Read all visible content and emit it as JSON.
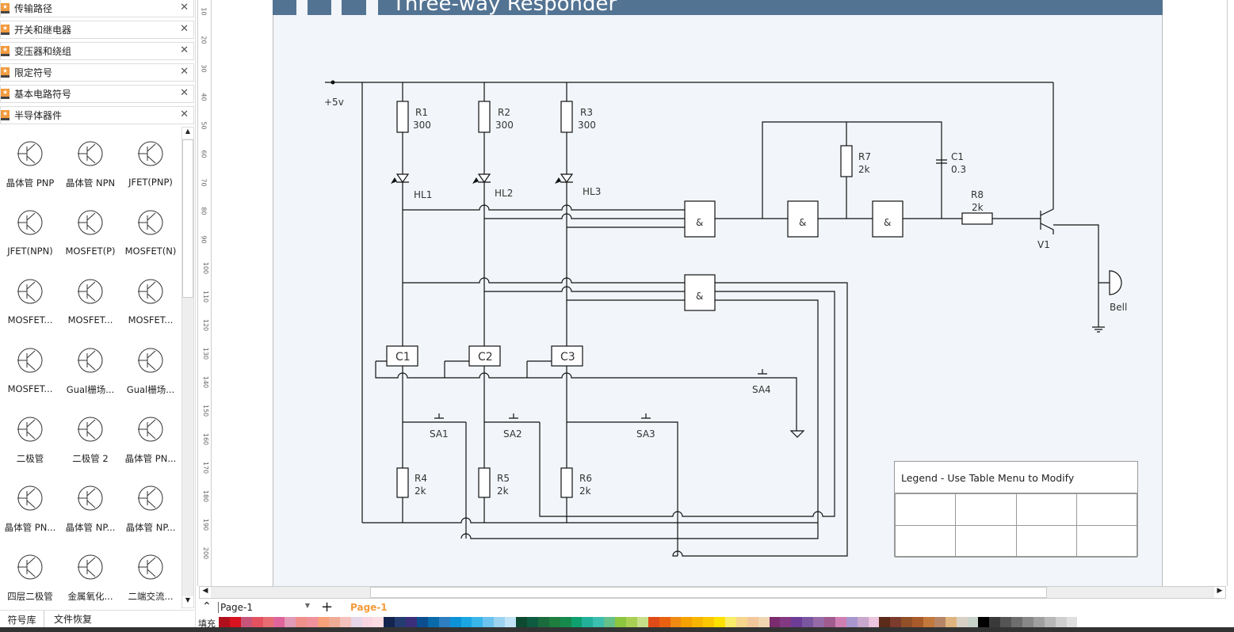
{
  "sidebar": {
    "categories": [
      "传输路径",
      "开关和继电器",
      "变压器和绕组",
      "限定符号",
      "基本电路符号",
      "半导体器件"
    ],
    "shapes": [
      "晶体管 PNP",
      "晶体管 NPN",
      "JFET(PNP)",
      "JFET(NPN)",
      "MOSFET(P)",
      "MOSFET(N)",
      "MOSFET...",
      "MOSFET...",
      "MOSFET...",
      "MOSFET...",
      "Gual栅场...",
      "Gual栅场...",
      "二极管",
      "二极管 2",
      "晶体管 PN...",
      "晶体管 PN...",
      "晶体管 NP...",
      "晶体管 NP...",
      "四层二极管",
      "金属氧化...",
      "二端交流..."
    ],
    "bottom_tabs": [
      "符号库",
      "文件恢复"
    ]
  },
  "ruler": [
    "10",
    "20",
    "30",
    "40",
    "50",
    "60",
    "70",
    "80",
    "90",
    "100",
    "110",
    "120",
    "130",
    "140",
    "150",
    "160",
    "170",
    "180",
    "190",
    "200"
  ],
  "diagram": {
    "title": "Three-way Responder",
    "supply": "+5v",
    "r1": "R1",
    "r1v": "300",
    "r2": "R2",
    "r2v": "300",
    "r3": "R3",
    "r3v": "300",
    "hl1": "HL1",
    "hl2": "HL2",
    "hl3": "HL3",
    "gate": "&",
    "r7": "R7",
    "r7v": "2k",
    "c1": "C1",
    "c1v": "0.3",
    "r8": "R8",
    "r8v": "2k",
    "v1": "V1",
    "bell": "Bell",
    "cc1": "C1",
    "cc2": "C2",
    "cc3": "C3",
    "sa1": "SA1",
    "sa2": "SA2",
    "sa3": "SA3",
    "sa4": "SA4",
    "r4": "R4",
    "r4v": "2k",
    "r5": "R5",
    "r5v": "2k",
    "r6": "R6",
    "r6v": "2k",
    "legend_title": "Legend - Use Table Menu to Modify"
  },
  "tabs": {
    "page_select": "Page-1",
    "active_page": "Page-1",
    "fill_label": "填充"
  },
  "colors": {
    "header": "#537393",
    "page_bg": "#f2f6fa",
    "active_tab": "#f39a3c"
  },
  "palette": [
    "#b0101c",
    "#d8121f",
    "#c8547a",
    "#e4525f",
    "#e86d73",
    "#e0649c",
    "#e19ab8",
    "#ef8f8a",
    "#ef929c",
    "#f7a07a",
    "#efab95",
    "#f4c1bc",
    "#e6d5e8",
    "#f9d5e2",
    "#fadde3",
    "#13254f",
    "#243c70",
    "#3b2e7a",
    "#0c4e8f",
    "#0b6aaa",
    "#2d7fc1",
    "#0d92d8",
    "#19a6e2",
    "#39b5ea",
    "#6cc3ef",
    "#9cd3f0",
    "#c0e3f5",
    "#0e4a32",
    "#0d5b40",
    "#1b6b3e",
    "#1e7e3e",
    "#16894d",
    "#0e9f6e",
    "#22b09a",
    "#3cbfae",
    "#65c08a",
    "#8cc63f",
    "#a9d055",
    "#c8df8a",
    "#e04a16",
    "#e86010",
    "#f08a12",
    "#f5a100",
    "#f7b500",
    "#fbc700",
    "#fde100",
    "#f8ec6a",
    "#f6d58d",
    "#f3c79b",
    "#f0d7b2",
    "#7b2c6e",
    "#843a82",
    "#6c3c96",
    "#7a56a0",
    "#976aa8",
    "#a05c8e",
    "#d07fb3",
    "#a896ce",
    "#c8a8cc",
    "#ecc5de",
    "#5c2a18",
    "#7b3b2d",
    "#925029",
    "#a85a2a",
    "#c3783c",
    "#b78667",
    "#e0b47e",
    "#d8d0c4",
    "#c7d2c8",
    "#000000",
    "#3a3a3a",
    "#555555",
    "#6e6e6e",
    "#888888",
    "#a0a0a0",
    "#b8b8b8",
    "#cfcfcf",
    "#e0e0e0"
  ]
}
